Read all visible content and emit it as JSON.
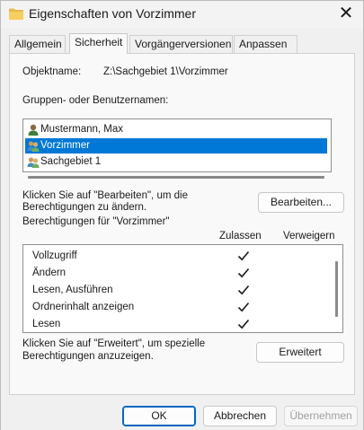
{
  "window": {
    "title": "Eigenschaften von Vorzimmer",
    "close_icon": "close-icon"
  },
  "tabs": [
    {
      "label": "Allgemein",
      "active": false
    },
    {
      "label": "Sicherheit",
      "active": true
    },
    {
      "label": "Vorgängerversionen",
      "active": false
    },
    {
      "label": "Anpassen",
      "active": false
    }
  ],
  "security": {
    "object_name_label": "Objektname:",
    "object_name_value": "Z:\\Sachgebiet 1\\Vorzimmer",
    "groups_label": "Gruppen- oder Benutzernamen:",
    "principals": [
      {
        "name": "Mustermann, Max",
        "icon": "user-icon",
        "selected": false
      },
      {
        "name": "Vorzimmer",
        "icon": "group-icon",
        "selected": true
      },
      {
        "name": "Sachgebiet 1",
        "icon": "group-icon",
        "selected": false
      }
    ],
    "edit_hint_line1": "Klicken Sie auf \"Bearbeiten\", um die",
    "edit_hint_line2": "Berechtigungen zu ändern.",
    "edit_button": "Bearbeiten...",
    "permissions_label": "Berechtigungen für \"Vorzimmer\"",
    "col_allow": "Zulassen",
    "col_deny": "Verweigern",
    "permissions": [
      {
        "name": "Vollzugriff",
        "allow": true,
        "deny": false
      },
      {
        "name": "Ändern",
        "allow": true,
        "deny": false
      },
      {
        "name": "Lesen, Ausführen",
        "allow": true,
        "deny": false
      },
      {
        "name": "Ordnerinhalt anzeigen",
        "allow": true,
        "deny": false
      },
      {
        "name": "Lesen",
        "allow": true,
        "deny": false
      }
    ],
    "advanced_hint_line1": "Klicken Sie auf \"Erweitert\", um spezielle",
    "advanced_hint_line2": "Berechtigungen anzuzeigen.",
    "advanced_button": "Erweitert"
  },
  "footer": {
    "ok": "OK",
    "cancel": "Abbrechen",
    "apply": "Übernehmen"
  },
  "colors": {
    "selection": "#0078d7",
    "primary_border": "#0067c0",
    "folder": "#e8b84a"
  }
}
